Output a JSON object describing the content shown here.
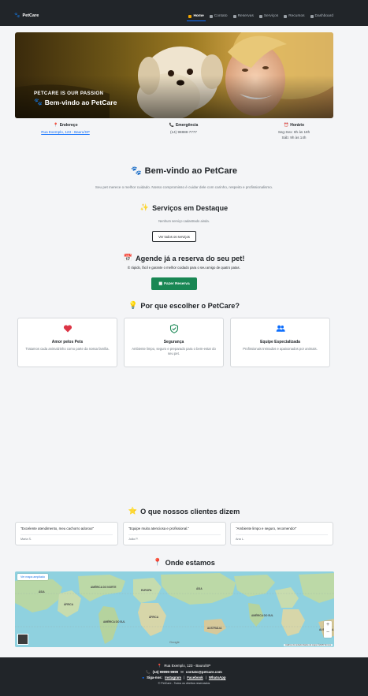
{
  "navbar": {
    "brand": "PetCare",
    "items": [
      {
        "label": "Home",
        "active": true,
        "icon": "house-icon"
      },
      {
        "label": "Contato",
        "active": false,
        "icon": "envelope-icon"
      },
      {
        "label": "Reservas",
        "active": false,
        "icon": "calendar-icon"
      },
      {
        "label": "Serviços",
        "active": false,
        "icon": "scissors-icon"
      },
      {
        "label": "Recursos",
        "active": false,
        "icon": "gear-icon"
      },
      {
        "label": "Dashboard",
        "active": false,
        "icon": "grid-icon"
      }
    ]
  },
  "hero": {
    "kicker": "PETCARE IS OUR PASSION",
    "title": "Bem-vindo ao PetCare"
  },
  "info": {
    "address": {
      "title": "Endereço",
      "link": "Rua Exemplo, 123 - Bauru/SP"
    },
    "emergency": {
      "title": "Emergência",
      "phone": "(14) 98888-7777"
    },
    "hours": {
      "title": "Horário",
      "line1": "Seg-Sex: 8h às 18h",
      "line2": "Sáb: 9h às 14h"
    }
  },
  "welcome": {
    "title": "Bem-vindo ao PetCare",
    "subtitle": "Seu pet merece o melhor cuidado. Nosso compromisso é cuidar dele com carinho, respeito e profissionalismo."
  },
  "featured": {
    "title": "Serviços em Destaque",
    "empty": "Nenhum serviço cadastrado ainda.",
    "button": "Ver todos os serviços"
  },
  "booking": {
    "title": "Agende já a reserva do seu pet!",
    "subtitle": "É rápido, fácil e garante o melhor cuidado para o seu amigo de quatro patas.",
    "button": "Fazer Reserva"
  },
  "why": {
    "title": "Por que escolher o PetCare?",
    "cards": [
      {
        "title": "Amor pelos Pets",
        "desc": "Tratamos cada animalzinho como parte da nossa família.",
        "icon": "heart-icon",
        "color": "#dc3545"
      },
      {
        "title": "Segurança",
        "desc": "Ambiente limpo, seguro e preparado para o bem-estar do seu pet.",
        "icon": "shield-check-icon",
        "color": "#198754"
      },
      {
        "title": "Equipe Especializada",
        "desc": "Profissionais treinados e apaixonados por animais.",
        "icon": "people-icon",
        "color": "#0d6efd"
      }
    ]
  },
  "testimonials": {
    "title": "O que nossos clientes dizem",
    "items": [
      {
        "quote": "\"Excelente atendimento, meu cachorro adorou!\"",
        "author": "Maria S."
      },
      {
        "quote": "\"Equipe muito atenciosa e profissional.\"",
        "author": "João P."
      },
      {
        "quote": "\"Ambiente limpo e seguro, recomendo!\"",
        "author": "Ana L."
      }
    ]
  },
  "location": {
    "title": "Onde estamos",
    "map_button": "Ver mapa ampliado",
    "map_footer": "Atalhos do teclado   Dados do mapa ©2025   Termos",
    "map_brand": "Google",
    "continents": [
      "ÁSIA",
      "ÁFRICA",
      "AMÉRICA DO NORTE",
      "AMÉRICA DO SUL",
      "ÁSIA",
      "ÁFRICA",
      "EUROPA",
      "AUSTRÁLIA",
      "AUSTRÁLIA",
      "AMÉRICA DO SUL"
    ]
  },
  "footer": {
    "address": "Rua Exemplo, 123 - Bauru/SP",
    "phone": "(14) 99999-9999",
    "email": "contato@petcare.com",
    "follow": "Siga-nos:",
    "instagram": "Instagram",
    "facebook": "Facebook",
    "whatsapp": "WhatsApp",
    "copyright": "© PetCare - Todos os direitos reservados"
  },
  "colors": {
    "primary": "#0d6efd",
    "success": "#198754",
    "danger": "#dc3545",
    "dark": "#212529",
    "background": "#f4f5f7"
  }
}
